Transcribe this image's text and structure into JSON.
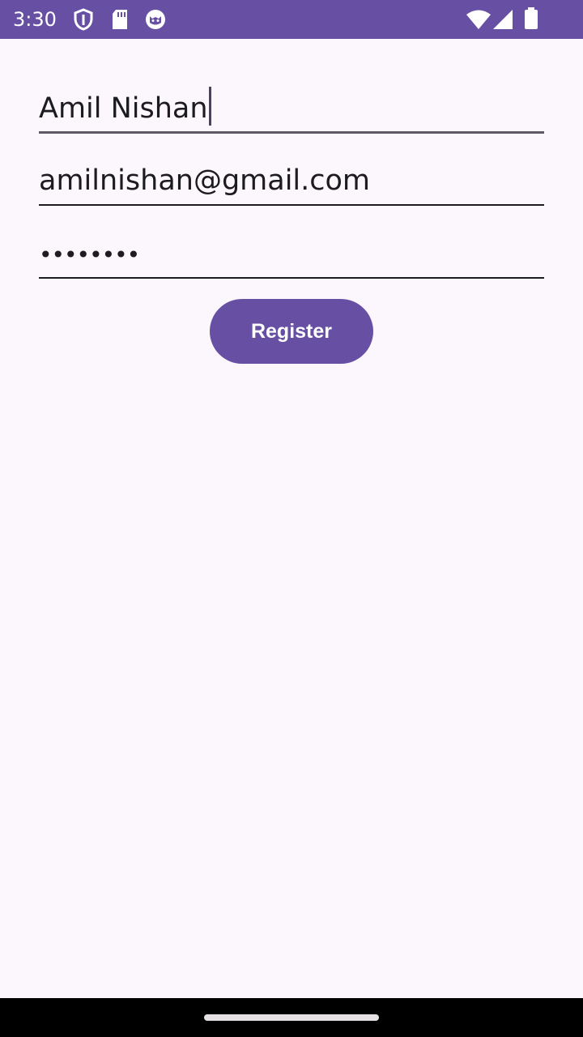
{
  "status_bar": {
    "time": "3:30",
    "icons_left": [
      "shield-icon",
      "sd-card-icon",
      "cat-face-icon"
    ],
    "icons_right": [
      "wifi-icon",
      "cellular-signal-icon",
      "battery-icon"
    ],
    "color": "#6750A4"
  },
  "form": {
    "name_value": "Amil Nishan",
    "email_value": "amilnishan@gmail.com",
    "password_masked": "••••••••",
    "focused_field": "name"
  },
  "register_button": {
    "label": "Register",
    "color": "#6750A4"
  },
  "colors": {
    "background": "#FCF7FD",
    "text": "#1C1B1F"
  }
}
